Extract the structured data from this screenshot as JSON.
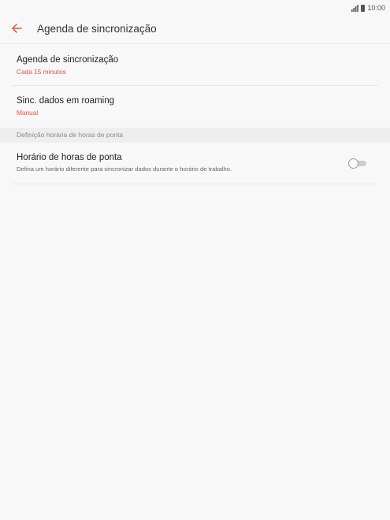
{
  "status_bar": {
    "time": "10:00",
    "icons": [
      "signal-icon",
      "battery-icon"
    ]
  },
  "header": {
    "back_icon": "arrow-left-icon",
    "title": "Agenda de sincronização"
  },
  "settings": {
    "sync_schedule": {
      "title": "Agenda de sincronização",
      "value": "Cada 15 minutos"
    },
    "roaming_sync": {
      "title": "Sinc. dados em roaming",
      "value": "Manual"
    }
  },
  "peak_section": {
    "header": "Definição horária de horas de ponta",
    "peak_schedule": {
      "title": "Horário de horas de ponta",
      "description": "Defina um horário diferente para sincronizar dados durante o horário de trabalho.",
      "enabled": false
    }
  },
  "colors": {
    "accent": "#e0513f",
    "background": "#f8f8f8",
    "section_background": "#eeeeee"
  }
}
